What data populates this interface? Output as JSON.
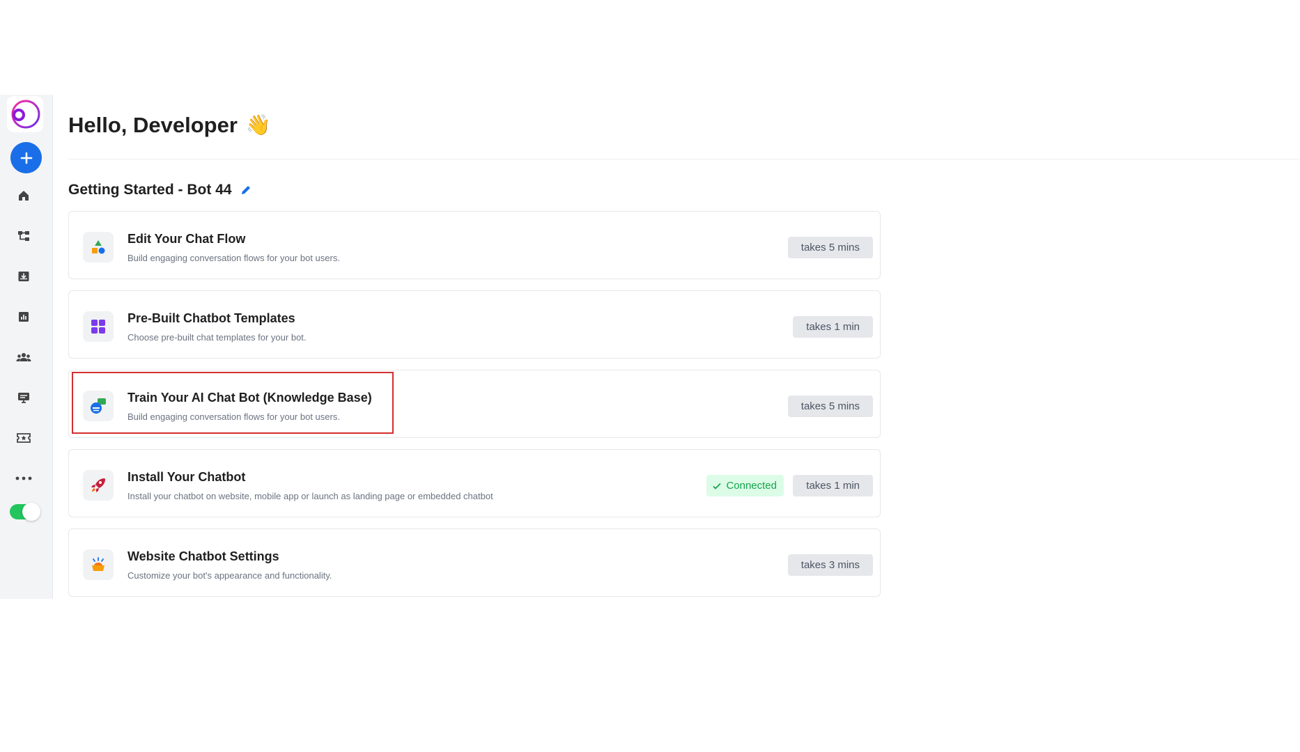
{
  "header": {
    "greeting": "Hello, Developer",
    "wave_emoji": "👋"
  },
  "section": {
    "title": "Getting Started - Bot 44"
  },
  "sidebar": {
    "items": [
      {
        "name": "home-icon"
      },
      {
        "name": "flow-icon"
      },
      {
        "name": "inbox-icon"
      },
      {
        "name": "analytics-icon"
      },
      {
        "name": "users-icon"
      },
      {
        "name": "monitor-icon"
      },
      {
        "name": "ticket-icon"
      },
      {
        "name": "more-icon"
      }
    ],
    "toggle_on": true
  },
  "cards": [
    {
      "title": "Edit Your Chat Flow",
      "desc": "Build engaging conversation flows for your bot users.",
      "badge": "takes 5 mins"
    },
    {
      "title": "Pre-Built Chatbot Templates",
      "desc": "Choose pre-built chat templates for your bot.",
      "badge": "takes 1 min"
    },
    {
      "title": "Train Your AI Chat Bot (Knowledge Base)",
      "desc": "Build engaging conversation flows for your bot users.",
      "badge": "takes 5 mins"
    },
    {
      "title": "Install Your Chatbot",
      "desc": "Install your chatbot on website, mobile app or launch as landing page or embedded chatbot",
      "badge": "takes 1 min",
      "status": "Connected"
    },
    {
      "title": "Website Chatbot Settings",
      "desc": "Customize your bot's appearance and functionality.",
      "badge": "takes 3 mins"
    }
  ],
  "colors": {
    "accent": "#1a6fe8",
    "toggle": "#22c55e",
    "connected_bg": "#dcfce7",
    "connected_text": "#16a34a",
    "highlight": "#d32f2f"
  }
}
